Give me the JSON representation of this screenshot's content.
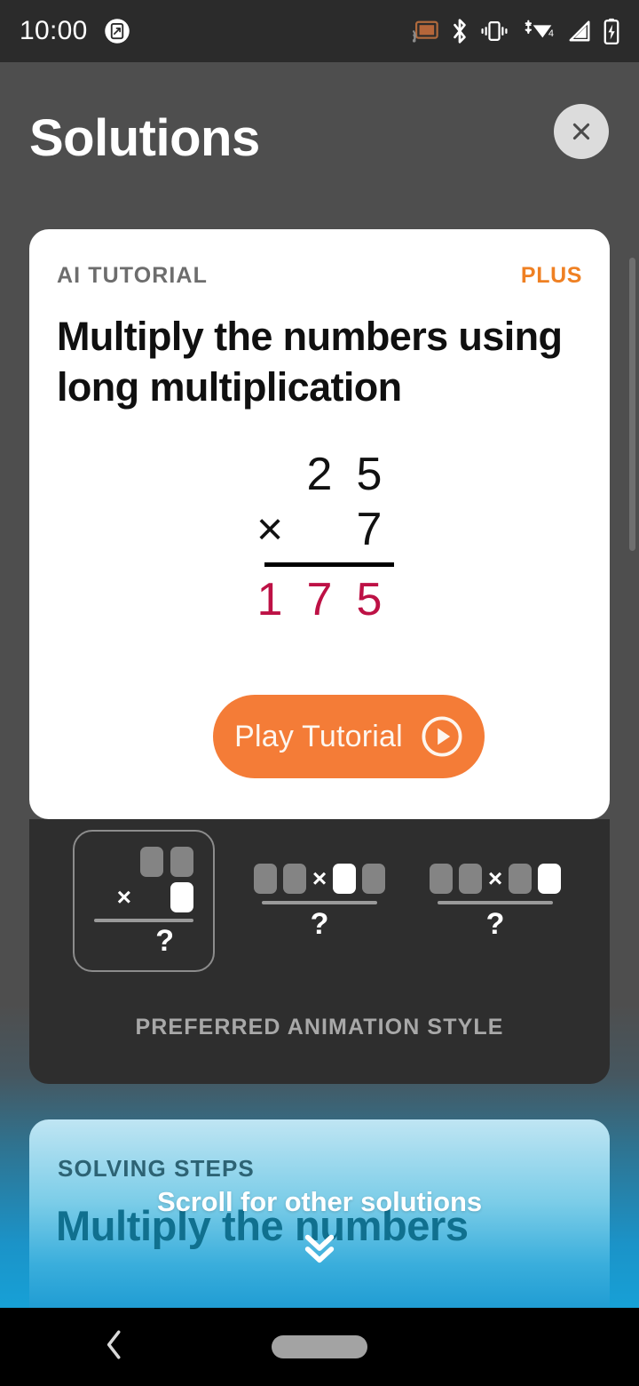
{
  "status_bar": {
    "time": "10:00",
    "icons": [
      "screenshot-icon",
      "cast-icon",
      "bluetooth-icon",
      "vibrate-icon",
      "wifi-icon",
      "cellular-signal-icon",
      "battery-charging-icon"
    ],
    "wifi_label": "4"
  },
  "header": {
    "title": "Solutions",
    "close_icon": "close-icon"
  },
  "tutorial_card": {
    "kicker": "AI TUTORIAL",
    "badge": "PLUS",
    "title": "Multiply the numbers using long multiplication",
    "play_button": {
      "label": "Play Tutorial",
      "icon": "play-circle-icon"
    },
    "math": {
      "operand_top": [
        "2",
        "5"
      ],
      "operator": "×",
      "operand_bottom": [
        "7"
      ],
      "result": [
        "1",
        "7",
        "5"
      ],
      "result_color": "#bd1145"
    }
  },
  "animation_styles": {
    "caption": "PREFERRED ANIMATION STYLE",
    "options": [
      {
        "name": "stacked-long-multiplication",
        "selected": true,
        "layout": "stacked",
        "top_blocks": [
          "gray",
          "gray"
        ],
        "bottom_blocks": [
          "white"
        ],
        "operator": "×",
        "result_glyph": "?"
      },
      {
        "name": "inline-multiply-first-digit",
        "selected": false,
        "layout": "inline",
        "blocks": [
          "gray",
          "gray",
          "operator",
          "white",
          "gray"
        ],
        "operator": "×",
        "result_glyph": "?"
      },
      {
        "name": "inline-multiply-second-digit",
        "selected": false,
        "layout": "inline",
        "blocks": [
          "gray",
          "gray",
          "operator",
          "gray",
          "white"
        ],
        "operator": "×",
        "result_glyph": "?"
      }
    ]
  },
  "solving_steps": {
    "kicker": "SOLVING STEPS",
    "title": "Multiply the numbers"
  },
  "scroll_hint": {
    "text": "Scroll for other solutions",
    "icon": "chevron-double-down-icon"
  },
  "nav_bar": {
    "back_icon": "back-chevron-icon",
    "home_icon": "home-pill-icon"
  },
  "colors": {
    "accent_orange": "#f47c37",
    "plus_orange": "#ef8023",
    "result_crimson": "#bd1145",
    "card_white": "#ffffff",
    "card_dark": "#2e2e2e",
    "steps_blue_top": "#bfe5f3",
    "steps_blue_bottom": "#1c9ad2",
    "page_gray": "#4e4e4e"
  }
}
